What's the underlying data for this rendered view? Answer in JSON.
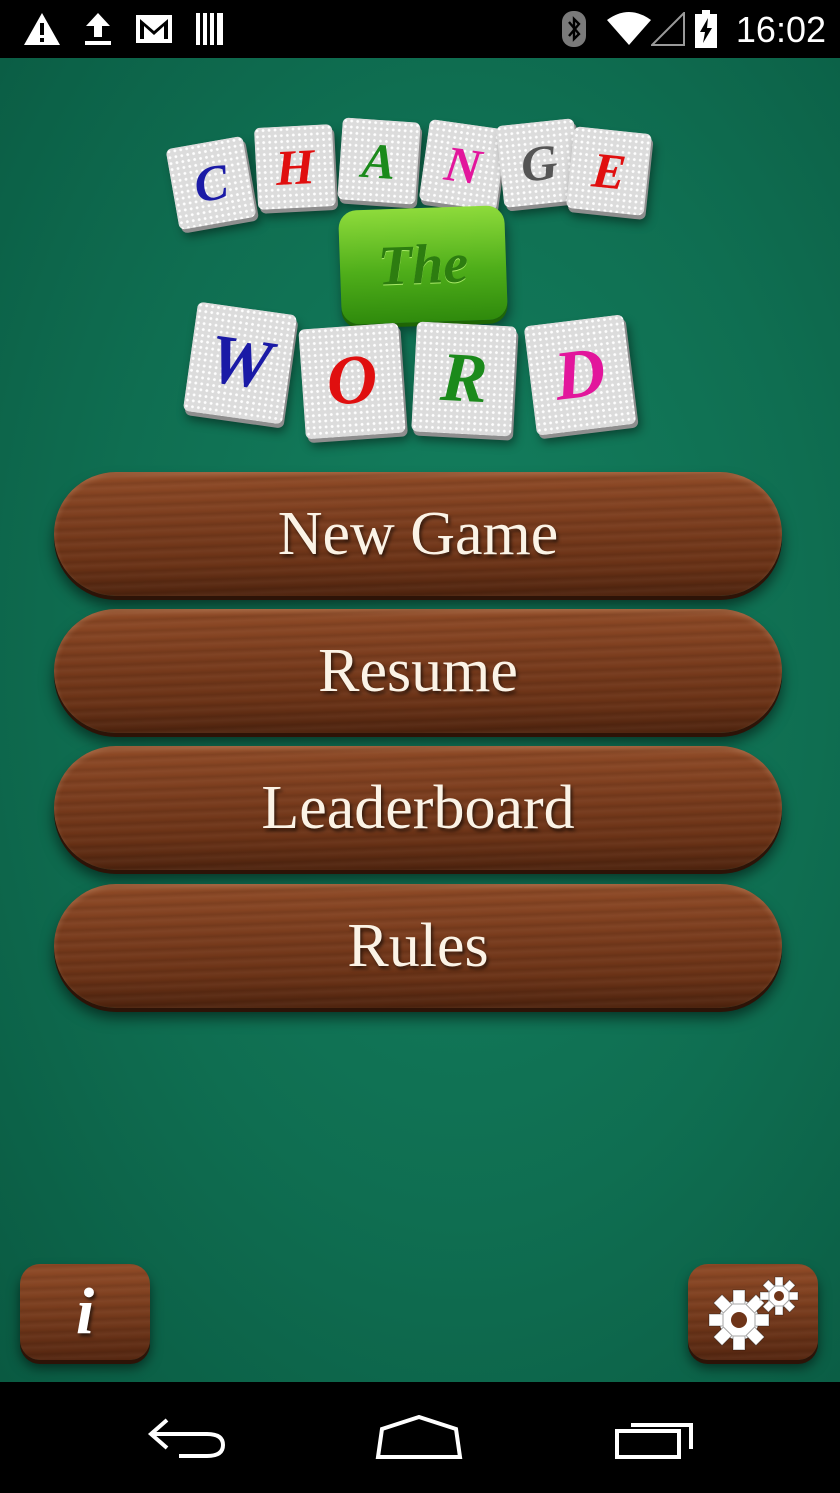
{
  "status_bar": {
    "time": "16:02",
    "left_icons": [
      "warning-icon",
      "upload-icon",
      "gmail-icon",
      "barcode-icon"
    ],
    "right_icons": [
      "bluetooth-icon",
      "wifi-icon",
      "signal-icon",
      "battery-charging-icon"
    ]
  },
  "logo": {
    "row1": [
      {
        "letter": "C",
        "color": "#1a1aa6"
      },
      {
        "letter": "H",
        "color": "#e00f0f"
      },
      {
        "letter": "A",
        "color": "#1b8a1b"
      },
      {
        "letter": "N",
        "color": "#e2169c"
      },
      {
        "letter": "G",
        "color": "#555555"
      },
      {
        "letter": "E",
        "color": "#e00f0f"
      }
    ],
    "middle": "The",
    "row2": [
      {
        "letter": "W",
        "color": "#1a1aa6"
      },
      {
        "letter": "O",
        "color": "#e00f0f"
      },
      {
        "letter": "R",
        "color": "#1b8a1b"
      },
      {
        "letter": "D",
        "color": "#e2169c"
      }
    ]
  },
  "menu": {
    "new_game": "New Game",
    "resume": "Resume",
    "leaderboard": "Leaderboard",
    "rules": "Rules"
  },
  "corner_buttons": {
    "info_label": "i",
    "settings_icon": "gears-icon"
  },
  "nav_bar": {
    "icons": [
      "back-icon",
      "home-icon",
      "recent-apps-icon"
    ]
  }
}
